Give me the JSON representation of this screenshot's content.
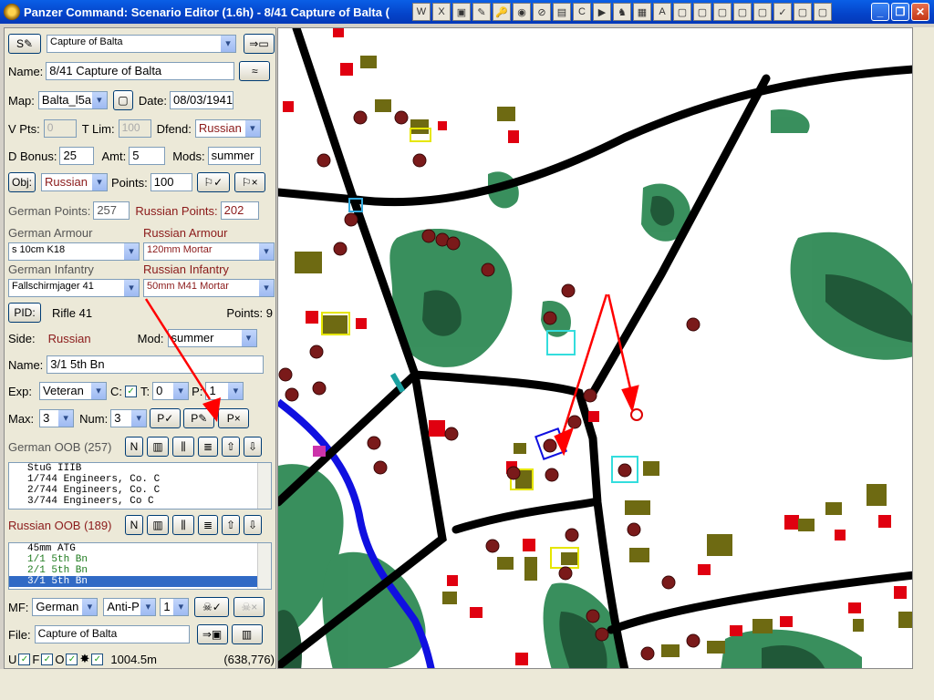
{
  "window": {
    "title": "Panzer Command: Scenario Editor (1.6h) - 8/41 Capture of Balta (",
    "minimize": "_",
    "restore": "❐",
    "close": "✕"
  },
  "quickbar": [
    "W",
    "X",
    "▣",
    "✎",
    "🔑",
    "◉",
    "⊘",
    "▤",
    "C",
    "▶",
    "♞",
    "▦",
    "A",
    "▢",
    "▢",
    "▢",
    "▢",
    "▢",
    "✓",
    "▢",
    "▢"
  ],
  "scenario": {
    "select_label": "S",
    "title_select": "Capture of Balta",
    "name_label": "Name:",
    "name_value": "8/41 Capture of Balta",
    "map_label": "Map:",
    "map_value": "Balta_l5a",
    "date_label": "Date:",
    "date_value": "08/03/1941",
    "vpts_label": "V Pts:",
    "vpts_value": "0",
    "tlim_label": "T Lim:",
    "tlim_value": "100",
    "dfend_label": "Dfend:",
    "dfend_value": "Russian",
    "dbonus_label": "D Bonus:",
    "dbonus_value": "25",
    "amt_label": "Amt:",
    "amt_value": "5",
    "mods_label": "Mods:",
    "mods_value": "summer",
    "obj_label": "Obj:",
    "obj_value": "Russian",
    "points_label": "Points:",
    "points_value": "100"
  },
  "forces": {
    "german_points_label": "German Points:",
    "german_points_value": "257",
    "russian_points_label": "Russian Points:",
    "russian_points_value": "202",
    "german_armour_label": "German Armour",
    "german_armour_value": "s 10cm K18",
    "russian_armour_label": "Russian Armour",
    "russian_armour_value": "120mm Mortar",
    "german_infantry_label": "German Infantry",
    "german_infantry_value": "Fallschirmjager 41",
    "russian_infantry_label": "Russian Infantry",
    "russian_infantry_value": "50mm M41 Mortar"
  },
  "unit": {
    "pid_label": "PID:",
    "type": "Rifle 41",
    "points_text": "Points: 9",
    "side_label": "Side:",
    "side_value": "Russian",
    "mod_label": "Mod:",
    "mod_value": "summer",
    "name_label": "Name:",
    "name_value": "3/1 5th Bn",
    "exp_label": "Exp:",
    "exp_value": "Veteran",
    "c_label": "C:",
    "t_label": "T:",
    "t_value": "0",
    "p_label": "P:",
    "p_value": "1",
    "max_label": "Max:",
    "max_value": "3",
    "num_label": "Num:",
    "num_value": "3",
    "p_ok": "P✓",
    "p_edit": "P✎",
    "p_del": "P×"
  },
  "german_oob": {
    "title": "German OOB (257)",
    "items": [
      "StuG IIIB",
      "1/744 Engineers, Co. C",
      "2/744 Engineers, Co. C",
      "3/744 Engineers, Co C"
    ]
  },
  "russian_oob": {
    "title": "Russian OOB (189)",
    "items": [
      "45mm ATG",
      "1/1 5th Bn",
      "2/1 5th Bn",
      "3/1 5th Bn"
    ]
  },
  "bottom": {
    "mf_label": "MF:",
    "mf_side": "German",
    "mf_type": "Anti-P",
    "mf_num": "1",
    "file_label": "File:",
    "file_value": "Capture of Balta",
    "u_label": "U",
    "f_label": "F",
    "o_label": "O",
    "distance": "1004.5m",
    "coords": "(638,776)"
  },
  "map": {
    "units": [
      {
        "type": "russian-infantry",
        "count": 28
      },
      {
        "type": "red-building",
        "count": 22
      },
      {
        "type": "olive-building",
        "count": 24
      }
    ]
  }
}
